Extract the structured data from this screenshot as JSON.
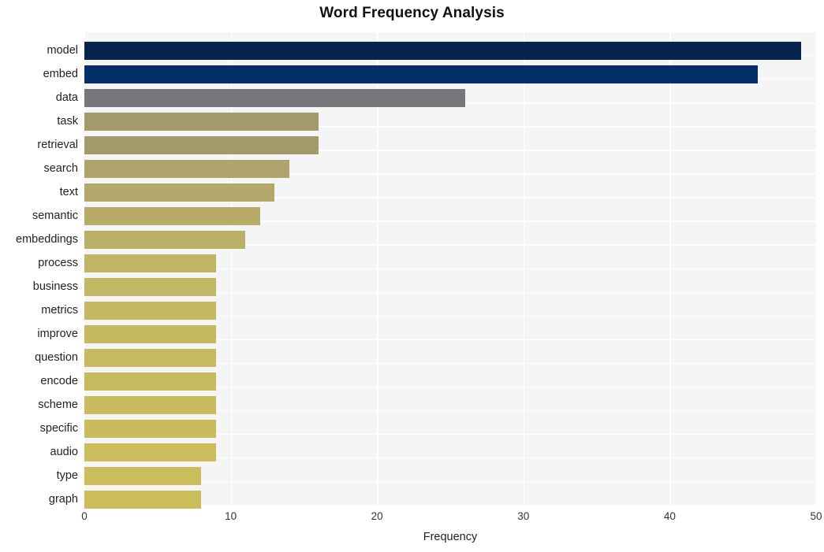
{
  "chart_data": {
    "type": "bar",
    "orientation": "horizontal",
    "title": "Word Frequency Analysis",
    "xlabel": "Frequency",
    "ylabel": "",
    "xlim": [
      0,
      50
    ],
    "xticks": [
      0,
      10,
      20,
      30,
      40,
      50
    ],
    "grid": true,
    "legend": null,
    "background": "#f5f5f5",
    "gridline_color": "#ffffff",
    "categories": [
      "model",
      "embed",
      "data",
      "task",
      "retrieval",
      "search",
      "text",
      "semantic",
      "embeddings",
      "process",
      "business",
      "metrics",
      "improve",
      "question",
      "encode",
      "scheme",
      "specific",
      "audio",
      "type",
      "graph"
    ],
    "values": [
      49,
      46,
      26,
      16,
      16,
      14,
      13,
      12,
      11,
      9,
      9,
      9,
      9,
      9,
      9,
      9,
      9,
      9,
      8,
      8
    ],
    "bar_colors": [
      "#06244e",
      "#033069",
      "#76777a",
      "#a39a6c",
      "#a39a6c",
      "#afa56c",
      "#b3a869",
      "#b6ab68",
      "#bab066",
      "#c0b563",
      "#c2b762",
      "#c4b860",
      "#c5b960",
      "#c7ba5f",
      "#c8bb5e",
      "#c9bb5e",
      "#cabc5d",
      "#cbbc5c",
      "#ccbd5c",
      "#ccbd5b"
    ]
  }
}
